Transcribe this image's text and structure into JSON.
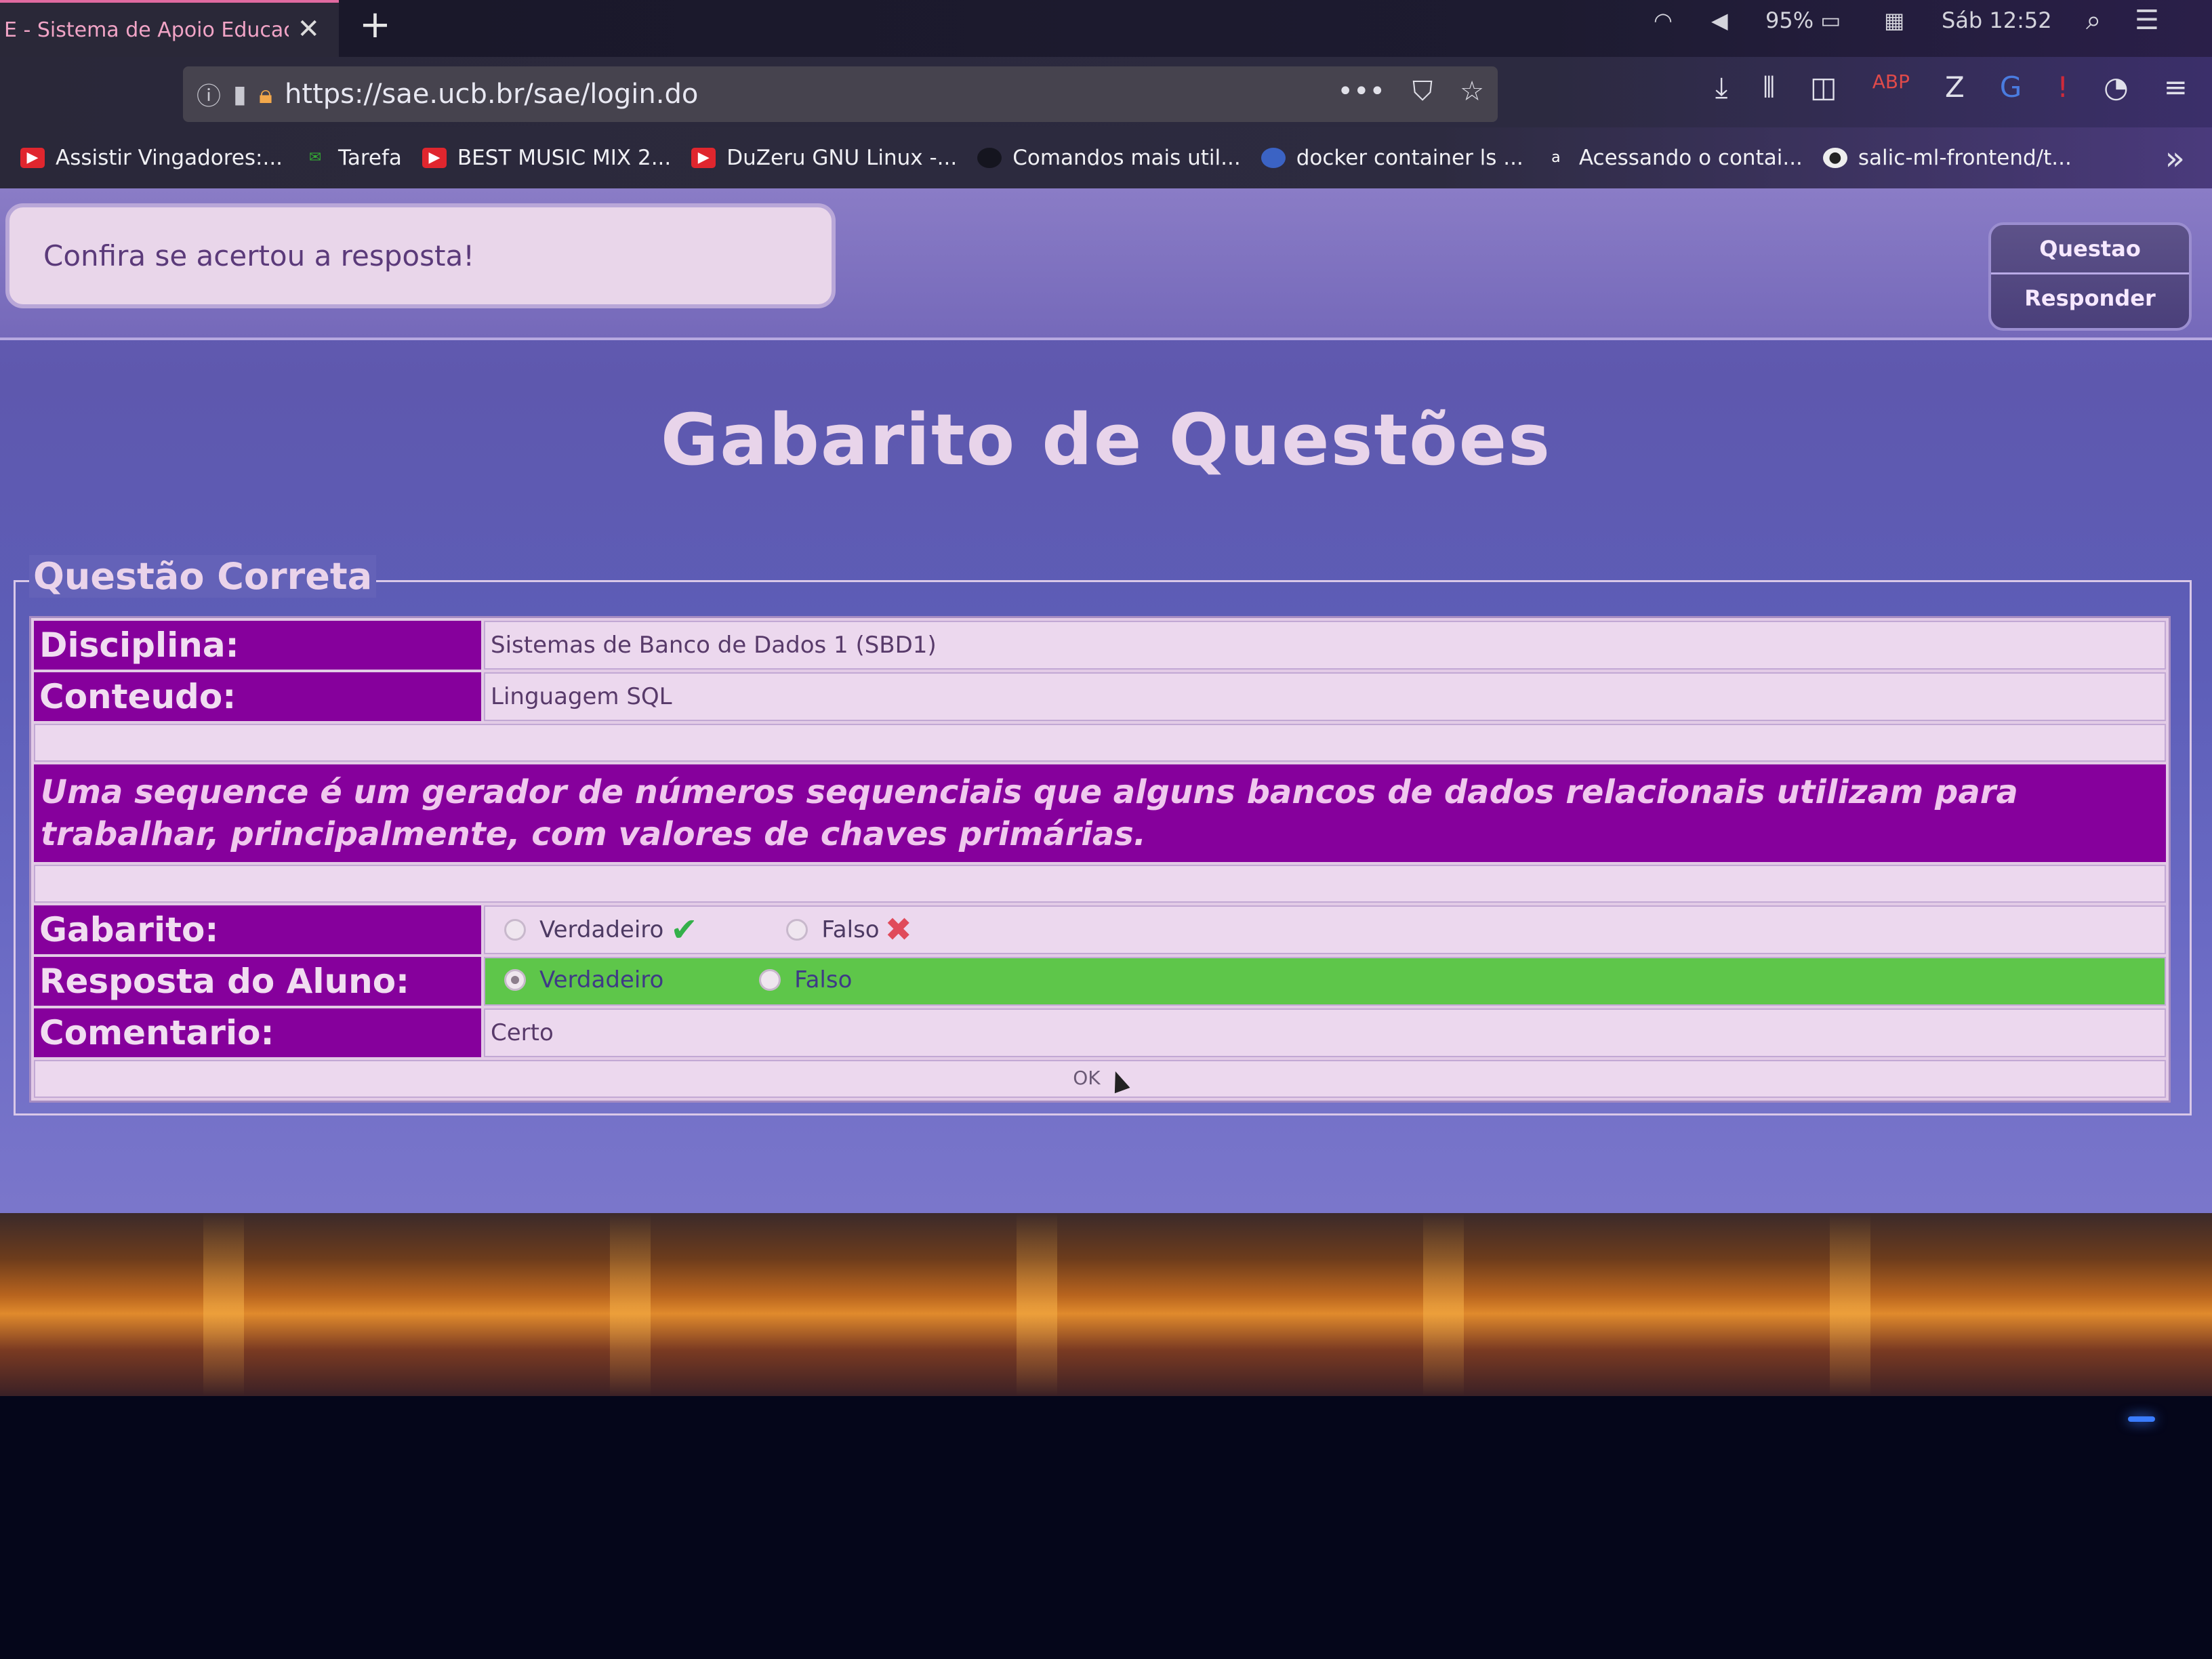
{
  "browser": {
    "tab_title": "E - Sistema de Apoio Educac",
    "url": "https://sae.ucb.br/sae/login.do",
    "battery": "95%",
    "clock": "Sáb 12:52",
    "bookmarks": [
      {
        "label": "Assistir Vingadores:...",
        "icon": "youtube-icon",
        "color": "#e0262e"
      },
      {
        "label": "Tarefa",
        "icon": "gmail-icon",
        "color": "#3a3"
      },
      {
        "label": "BEST MUSIC MIX 2...",
        "icon": "youtube-icon",
        "color": "#e0262e"
      },
      {
        "label": "DuZeru GNU Linux -...",
        "icon": "youtube-icon",
        "color": "#e0262e"
      },
      {
        "label": "Comandos mais util...",
        "icon": "site-icon",
        "color": "#2a2a3a"
      },
      {
        "label": "docker container ls ...",
        "icon": "docker-icon",
        "color": "#3b63c4"
      },
      {
        "label": "Acessando o contai...",
        "icon": "amazon-icon",
        "color": "#333"
      },
      {
        "label": "salic-ml-frontend/t...",
        "icon": "github-icon",
        "color": "#222"
      }
    ]
  },
  "page": {
    "message": "Confira se acertou a resposta!",
    "menu": [
      "Questao",
      "Responder"
    ],
    "title": "Gabarito de Questões",
    "section_legend": "Questão Correta",
    "rows": {
      "disciplina_label": "Disciplina:",
      "disciplina_value": "Sistemas de Banco de Dados 1 (SBD1)",
      "conteudo_label": "Conteudo:",
      "conteudo_value": "Linguagem SQL",
      "question": "Uma sequence é um gerador de números sequenciais que alguns bancos de dados relacionais utilizam para trabalhar, principalmente, com valores de chaves primárias.",
      "gabarito_label": "Gabarito:",
      "resposta_label": "Resposta do Aluno:",
      "comentario_label": "Comentario:",
      "comentario_value": "Certo",
      "option_true": "Verdadeiro",
      "option_false": "Falso",
      "ok": "OK"
    },
    "colors": {
      "label_bg": "#86009c",
      "correct_bg": "#5ec64a",
      "background": "#6462b8"
    }
  }
}
